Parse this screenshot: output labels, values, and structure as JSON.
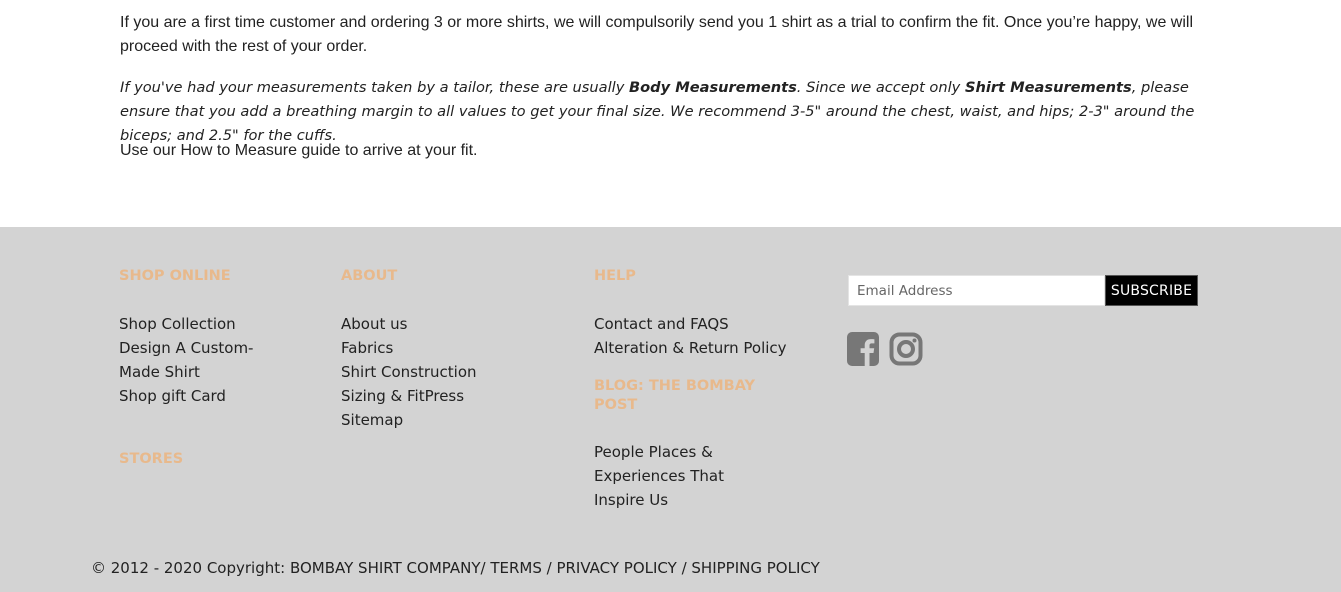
{
  "content": {
    "para1": "If you are a first time customer and ordering 3 or more shirts, we will compulsorily send you 1 shirt as a trial to confirm the fit. Once you’re happy, we will proceed with the rest of your order.",
    "para2": {
      "part1": "If you've had your measurements taken by a tailor, these are usually ",
      "bold1": "Body Measurements",
      "part2": ". Since we accept only ",
      "bold2": "Shirt Measurements",
      "part3": ", please ensure that you add a breathing margin to all values to get your final size. We recommend 3-5\" around the chest, waist, and hips; 2-3\" around the biceps; and 2.5\" for the cuffs."
    },
    "para3": {
      "prefix": "Use our ",
      "link": "How to Measure guide",
      "suffix": " to arrive at your fit."
    }
  },
  "footer": {
    "shop_online": {
      "heading": "SHOP ONLINE",
      "items": [
        "Shop Collection",
        "Design A Custom-Made Shirt",
        "Shop gift Card"
      ]
    },
    "stores": {
      "heading": "STORES"
    },
    "about": {
      "heading": "ABOUT",
      "items": [
        "About us",
        "Fabrics",
        "Shirt Construction",
        "Sizing & FitPress",
        "Sitemap"
      ]
    },
    "help": {
      "heading": "HELP",
      "items": [
        "Contact and FAQS",
        "Alteration & Return Policy"
      ]
    },
    "blog": {
      "heading": "BLOG: THE BOMBAY POST",
      "items": [
        "People Places & Experiences That Inspire Us"
      ]
    },
    "newsletter": {
      "placeholder": "Email Address",
      "button": "SUBSCRIBE"
    },
    "social": {
      "icons": [
        "facebook-icon",
        "instagram-icon"
      ],
      "color": "#777777"
    },
    "copyright": {
      "text": "© 2012 - 2020 Copyright: ",
      "company": "BOMBAY SHIRT COMPANY",
      "sep1": "/ ",
      "terms": "TERMS",
      "sep2": " / ",
      "privacy": "PRIVACY POLICY",
      "sep3": " / ",
      "shipping": "SHIPPING POLICY"
    }
  },
  "colors": {
    "footer_bg": "#d3d3d3",
    "heading": "#e8b98c",
    "button_bg": "#000000"
  }
}
